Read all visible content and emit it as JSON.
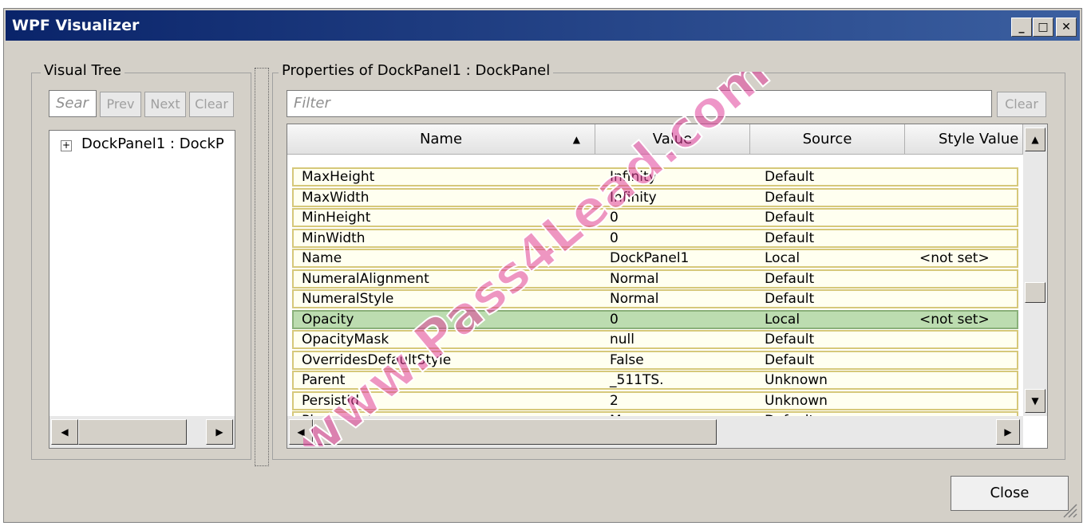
{
  "window": {
    "title": "WPF Visualizer",
    "minimize_glyph": "_",
    "maximize_glyph": "□",
    "close_glyph": "✕"
  },
  "visual_tree": {
    "group_label": "Visual Tree",
    "search_placeholder": "Sear",
    "prev_label": "Prev",
    "next_label": "Next",
    "clear_label": "Clear",
    "root_node": {
      "expander": "+",
      "label": "DockPanel1 : DockP"
    }
  },
  "properties": {
    "group_label": "Properties of DockPanel1 : DockPanel",
    "filter_placeholder": "Filter",
    "clear_label": "Clear",
    "columns": [
      "Name",
      "Value",
      "Source",
      "Style Value"
    ],
    "sort_column": "Name",
    "rows": [
      {
        "name": "MaxHeight",
        "value": "Infinity",
        "source": "Default",
        "style": ""
      },
      {
        "name": "MaxWidth",
        "value": "Infinity",
        "source": "Default",
        "style": ""
      },
      {
        "name": "MinHeight",
        "value": "0",
        "source": "Default",
        "style": ""
      },
      {
        "name": "MinWidth",
        "value": "0",
        "source": "Default",
        "style": ""
      },
      {
        "name": "Name",
        "value": "DockPanel1",
        "source": "Local",
        "style": "<not set>"
      },
      {
        "name": "NumeralAlignment",
        "value": "Normal",
        "source": "Default",
        "style": ""
      },
      {
        "name": "NumeralStyle",
        "value": "Normal",
        "source": "Default",
        "style": ""
      },
      {
        "name": "Opacity",
        "value": "0",
        "source": "Local",
        "style": "<not set>",
        "selected": true
      },
      {
        "name": "OpacityMask",
        "value": "null",
        "source": "Default",
        "style": ""
      },
      {
        "name": "OverridesDefaultStyle",
        "value": "False",
        "source": "Default",
        "style": ""
      },
      {
        "name": "Parent",
        "value": "_511TS.",
        "source": "Unknown",
        "style": ""
      },
      {
        "name": "PersistId",
        "value": "2",
        "source": "Unknown",
        "style": ""
      },
      {
        "name": "Placement",
        "value": "Mouse",
        "source": "Default",
        "style": ""
      }
    ]
  },
  "close_label": "Close",
  "watermark": "www.Pass4Lead.com",
  "colors": {
    "title_bar": "#0a246a",
    "row_bg": "#fffff0",
    "row_border": "#d6c87a",
    "selected_row": "#bcdcb0",
    "watermark": "#e0409a"
  }
}
